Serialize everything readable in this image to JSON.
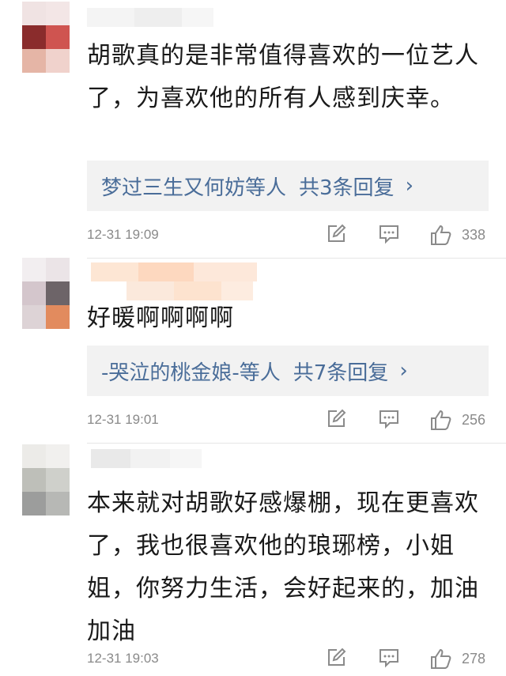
{
  "comments": [
    {
      "text": "胡歌真的是非常值得喜欢的一位艺人了，为喜欢他的所有人感到庆幸。",
      "replies": {
        "names": "梦过三生又何妨等人",
        "count": "共3条回复"
      },
      "time": "12-31 19:09",
      "likes": "338"
    },
    {
      "text": "好暖啊啊啊啊",
      "replies": {
        "names": "-哭泣的桃金娘-等人",
        "count": "共7条回复"
      },
      "time": "12-31 19:01",
      "likes": "256"
    },
    {
      "text": "本来就对胡歌好感爆棚，现在更喜欢了，我也很喜欢他的琅琊榜，小姐姐，你努力生活，会好起来的，加油加油",
      "time": "12-31 19:03",
      "likes": "278"
    }
  ],
  "icons": {
    "edit": "edit-icon",
    "comment": "comment-icon",
    "like": "thumbs-up-icon",
    "chevron": "chevron-right-icon"
  },
  "colors": {
    "link": "#4a6d99",
    "meta": "#8a8a8a",
    "reply_bg": "#f2f2f2"
  }
}
